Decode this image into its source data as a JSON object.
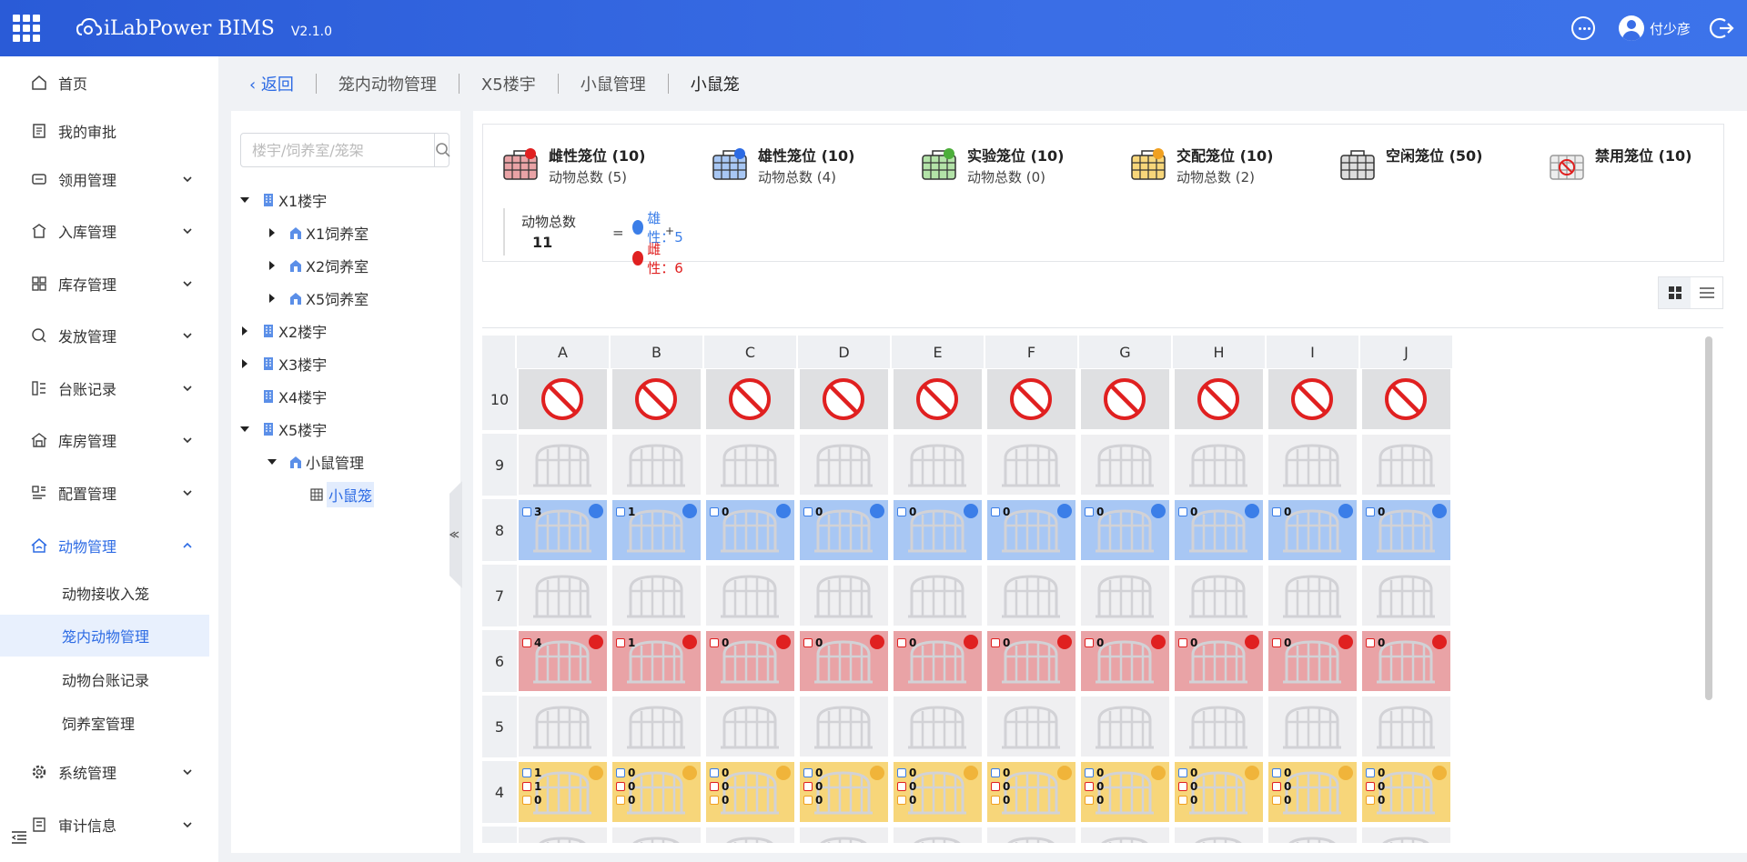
{
  "header": {
    "app_name": "iLabPower BIMS",
    "version": "V2.1.0",
    "user_name": "付少彦"
  },
  "sidebar": {
    "items": [
      {
        "label": "首页",
        "icon": "home-icon"
      },
      {
        "label": "我的审批",
        "icon": "approval-icon"
      },
      {
        "label": "领用管理",
        "icon": "requisition-icon"
      },
      {
        "label": "入库管理",
        "icon": "inbound-icon"
      },
      {
        "label": "库存管理",
        "icon": "inventory-icon"
      },
      {
        "label": "发放管理",
        "icon": "distribute-icon"
      },
      {
        "label": "台账记录",
        "icon": "ledger-icon"
      },
      {
        "label": "库房管理",
        "icon": "warehouse-icon"
      },
      {
        "label": "配置管理",
        "icon": "config-icon"
      },
      {
        "label": "动物管理",
        "icon": "animal-icon"
      },
      {
        "label": "系统管理",
        "icon": "system-gear-icon"
      },
      {
        "label": "审计信息",
        "icon": "audit-icon"
      }
    ],
    "sub_items": [
      {
        "label": "动物接收入笼"
      },
      {
        "label": "笼内动物管理"
      },
      {
        "label": "动物台账记录"
      },
      {
        "label": "饲养室管理"
      }
    ]
  },
  "breadcrumb": {
    "back": "返回",
    "items": [
      "笼内动物管理",
      "X5楼宇",
      "小鼠管理",
      "小鼠笼"
    ]
  },
  "tree": {
    "search_placeholder": "楼宇/饲养室/笼架",
    "nodes": [
      {
        "label": "X1楼宇"
      },
      {
        "label": "X1饲养室"
      },
      {
        "label": "X2饲养室"
      },
      {
        "label": "X5饲养室"
      },
      {
        "label": "X2楼宇"
      },
      {
        "label": "X3楼宇"
      },
      {
        "label": "X4楼宇"
      },
      {
        "label": "X5楼宇"
      },
      {
        "label": "小鼠管理"
      },
      {
        "label": "小鼠笼"
      }
    ]
  },
  "stats": {
    "female": {
      "title": "雌性笼位 (10)",
      "sub": "动物总数 (5)"
    },
    "male": {
      "title": "雄性笼位 (10)",
      "sub": "动物总数 (4)"
    },
    "experiment": {
      "title": "实验笼位 (10)",
      "sub": "动物总数 (0)"
    },
    "mating": {
      "title": "交配笼位 (10)",
      "sub": "动物总数 (2)"
    },
    "idle": {
      "title": "空闲笼位 (50)"
    },
    "banned": {
      "title": "禁用笼位 (10)"
    },
    "total_label": "动物总数",
    "total_value": "11",
    "equals": "=",
    "plus": "+",
    "male_total": "雄性：5",
    "female_total": "雌性：6"
  },
  "grid": {
    "columns": [
      "A",
      "B",
      "C",
      "D",
      "E",
      "F",
      "G",
      "H",
      "I",
      "J"
    ],
    "rows": [
      {
        "label": "10",
        "type": "disabled"
      },
      {
        "label": "9",
        "type": "empty"
      },
      {
        "label": "8",
        "type": "male",
        "counts": [
          "3",
          "1",
          "0",
          "0",
          "0",
          "0",
          "0",
          "0",
          "0",
          "0"
        ]
      },
      {
        "label": "7",
        "type": "empty"
      },
      {
        "label": "6",
        "type": "female",
        "counts": [
          "4",
          "1",
          "0",
          "0",
          "0",
          "0",
          "0",
          "0",
          "0",
          "0"
        ]
      },
      {
        "label": "5",
        "type": "empty"
      },
      {
        "label": "4",
        "type": "mating",
        "counts_male": [
          "1",
          "0",
          "0",
          "0",
          "0",
          "0",
          "0",
          "0",
          "0",
          "0"
        ],
        "counts_female": [
          "1",
          "0",
          "0",
          "0",
          "0",
          "0",
          "0",
          "0",
          "0",
          "0"
        ],
        "counts_pup": [
          "0",
          "0",
          "0",
          "0",
          "0",
          "0",
          "0",
          "0",
          "0",
          "0"
        ]
      }
    ]
  },
  "colors": {
    "primary": "#2d6be4",
    "male": "#a8c7f4",
    "female": "#e9a3a6",
    "mating": "#f7d67a",
    "ban": "#e02020"
  }
}
